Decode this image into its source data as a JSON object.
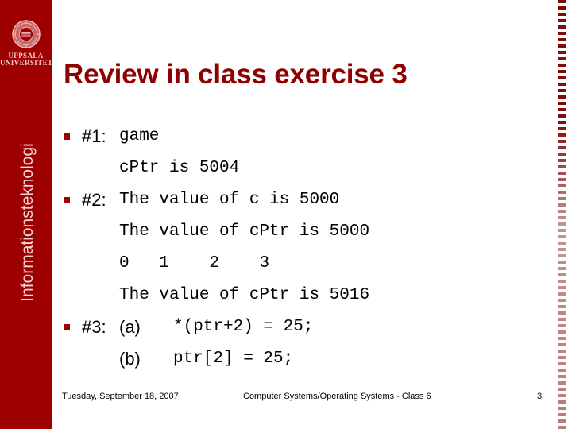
{
  "colors": {
    "brand_red": "#9e0000",
    "title_red": "#8f0000",
    "rule_red": "#7e0d0d",
    "wordmark_pink": "#f3c9c9"
  },
  "sidebar": {
    "logo": {
      "icon": "uppsala-university-seal",
      "wordmark_line1": "UPPSALA",
      "wordmark_line2": "UNIVERSITET"
    },
    "department_label": "Informationsteknologi"
  },
  "slide": {
    "title": "Review in class exercise 3",
    "items": [
      {
        "bullet": true,
        "tag": "#1:",
        "sublabel": "",
        "code": "game"
      },
      {
        "bullet": false,
        "tag": "",
        "sublabel": "",
        "code": "cPtr is 5004"
      },
      {
        "bullet": true,
        "tag": "#2:",
        "sublabel": "",
        "code": "The value of c is 5000"
      },
      {
        "bullet": false,
        "tag": "",
        "sublabel": "",
        "code": "The value of cPtr is 5000"
      },
      {
        "bullet": false,
        "tag": "",
        "sublabel": "",
        "code": "0   1    2    3"
      },
      {
        "bullet": false,
        "tag": "",
        "sublabel": "",
        "code": "The value of cPtr is 5016"
      },
      {
        "bullet": true,
        "tag": "#3:",
        "sublabel": "(a)",
        "code": "*(ptr+2) = 25;"
      },
      {
        "bullet": false,
        "tag": "",
        "sublabel": "(b)",
        "code": "ptr[2] = 25;"
      }
    ]
  },
  "footer": {
    "date": "Tuesday, September 18, 2007",
    "center": "Computer Systems/Operating Systems - Class 6",
    "page_number": "3"
  }
}
